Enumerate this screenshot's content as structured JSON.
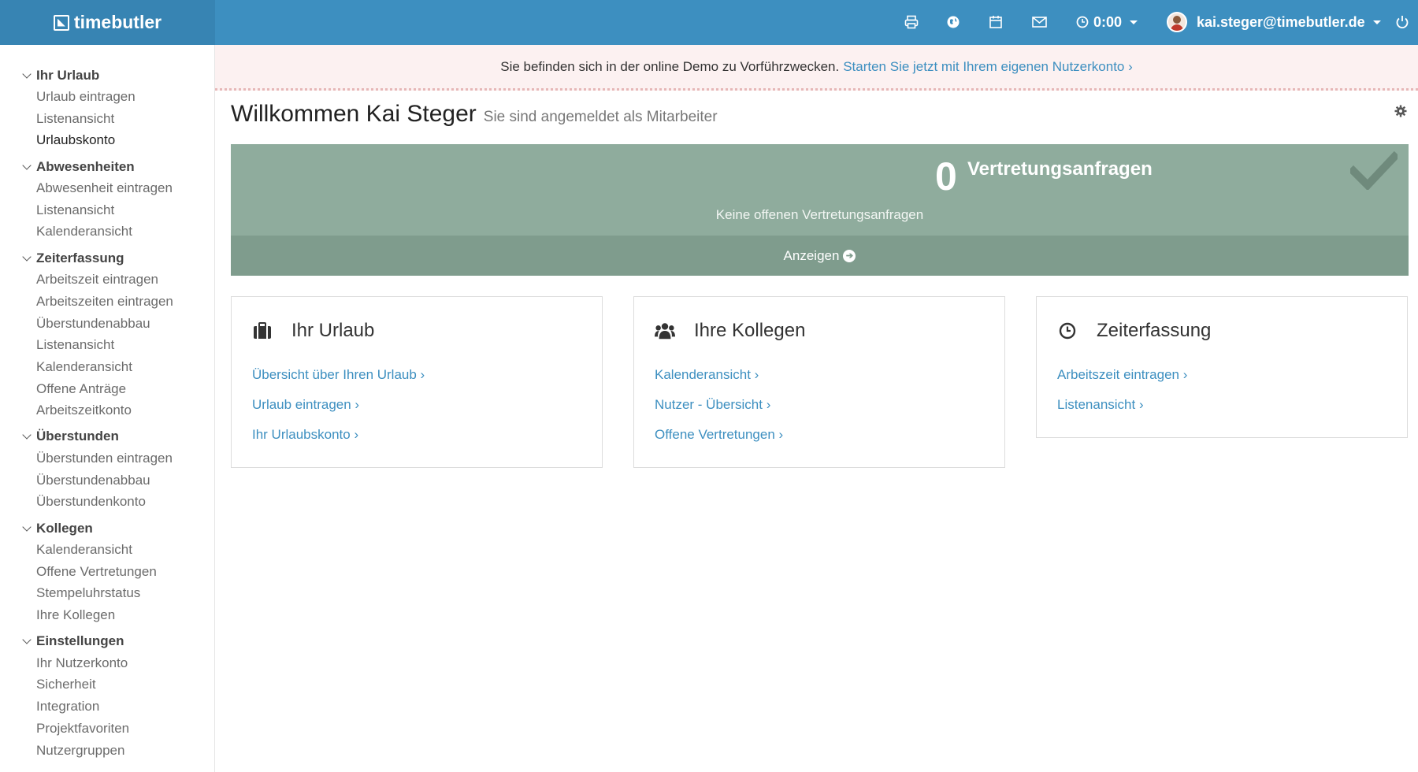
{
  "topbar": {
    "logo_text": "timebutler",
    "timer_value": "0:00",
    "user_email": "kai.steger@timebutler.de",
    "icons": [
      "print-icon",
      "globe-icon",
      "calendar-icon",
      "mail-icon",
      "clock-icon",
      "power-icon"
    ],
    "brand_color": "#3d8fc0"
  },
  "sidebar": {
    "sections": [
      {
        "title": "Ihr Urlaub",
        "items": [
          "Urlaub eintragen",
          "Listenansicht",
          "Urlaubskonto"
        ]
      },
      {
        "title": "Abwesenheiten",
        "items": [
          "Abwesenheit eintragen",
          "Listenansicht",
          "Kalenderansicht"
        ]
      },
      {
        "title": "Zeiterfassung",
        "items": [
          "Arbeitszeit eintragen",
          "Arbeitszeiten eintragen",
          "Überstundenabbau",
          "Listenansicht",
          "Kalenderansicht",
          "Offene Anträge",
          "Arbeitszeitkonto"
        ]
      },
      {
        "title": "Überstunden",
        "items": [
          "Überstunden eintragen",
          "Überstundenabbau",
          "Überstundenkonto"
        ]
      },
      {
        "title": "Kollegen",
        "items": [
          "Kalenderansicht",
          "Offene Vertretungen",
          "Stempeluhrstatus",
          "Ihre Kollegen"
        ]
      },
      {
        "title": "Einstellungen",
        "items": [
          "Ihr Nutzerkonto",
          "Sicherheit",
          "Integration",
          "Projektfavoriten",
          "Nutzergruppen"
        ]
      }
    ],
    "active_item": "Urlaubskonto"
  },
  "banner": {
    "text": "Sie befinden sich in der online Demo zu Vorführzwecken.",
    "link": "Starten Sie jetzt mit Ihrem eigenen Nutzerkonto ›"
  },
  "welcome": {
    "title": "Willkommen Kai Steger",
    "subtitle": "Sie sind angemeldet als Mitarbeiter"
  },
  "vertretung": {
    "count": "0",
    "title": "Vertretungsanfragen",
    "subtitle": "Keine offenen Vertretungsanfragen",
    "button": "Anzeigen"
  },
  "cards": [
    {
      "title": "Ihr Urlaub",
      "icon": "suitcase-icon",
      "links": [
        "Übersicht über Ihren Urlaub ›",
        "Urlaub eintragen ›",
        "Ihr Urlaubskonto ›"
      ]
    },
    {
      "title": "Ihre Kollegen",
      "icon": "users-icon",
      "links": [
        "Kalenderansicht ›",
        "Nutzer - Übersicht ›",
        "Offene Vertretungen ›"
      ]
    },
    {
      "title": "Zeiterfassung",
      "icon": "clock-icon",
      "links": [
        "Arbeitszeit eintragen ›",
        "Listenansicht ›"
      ]
    }
  ]
}
